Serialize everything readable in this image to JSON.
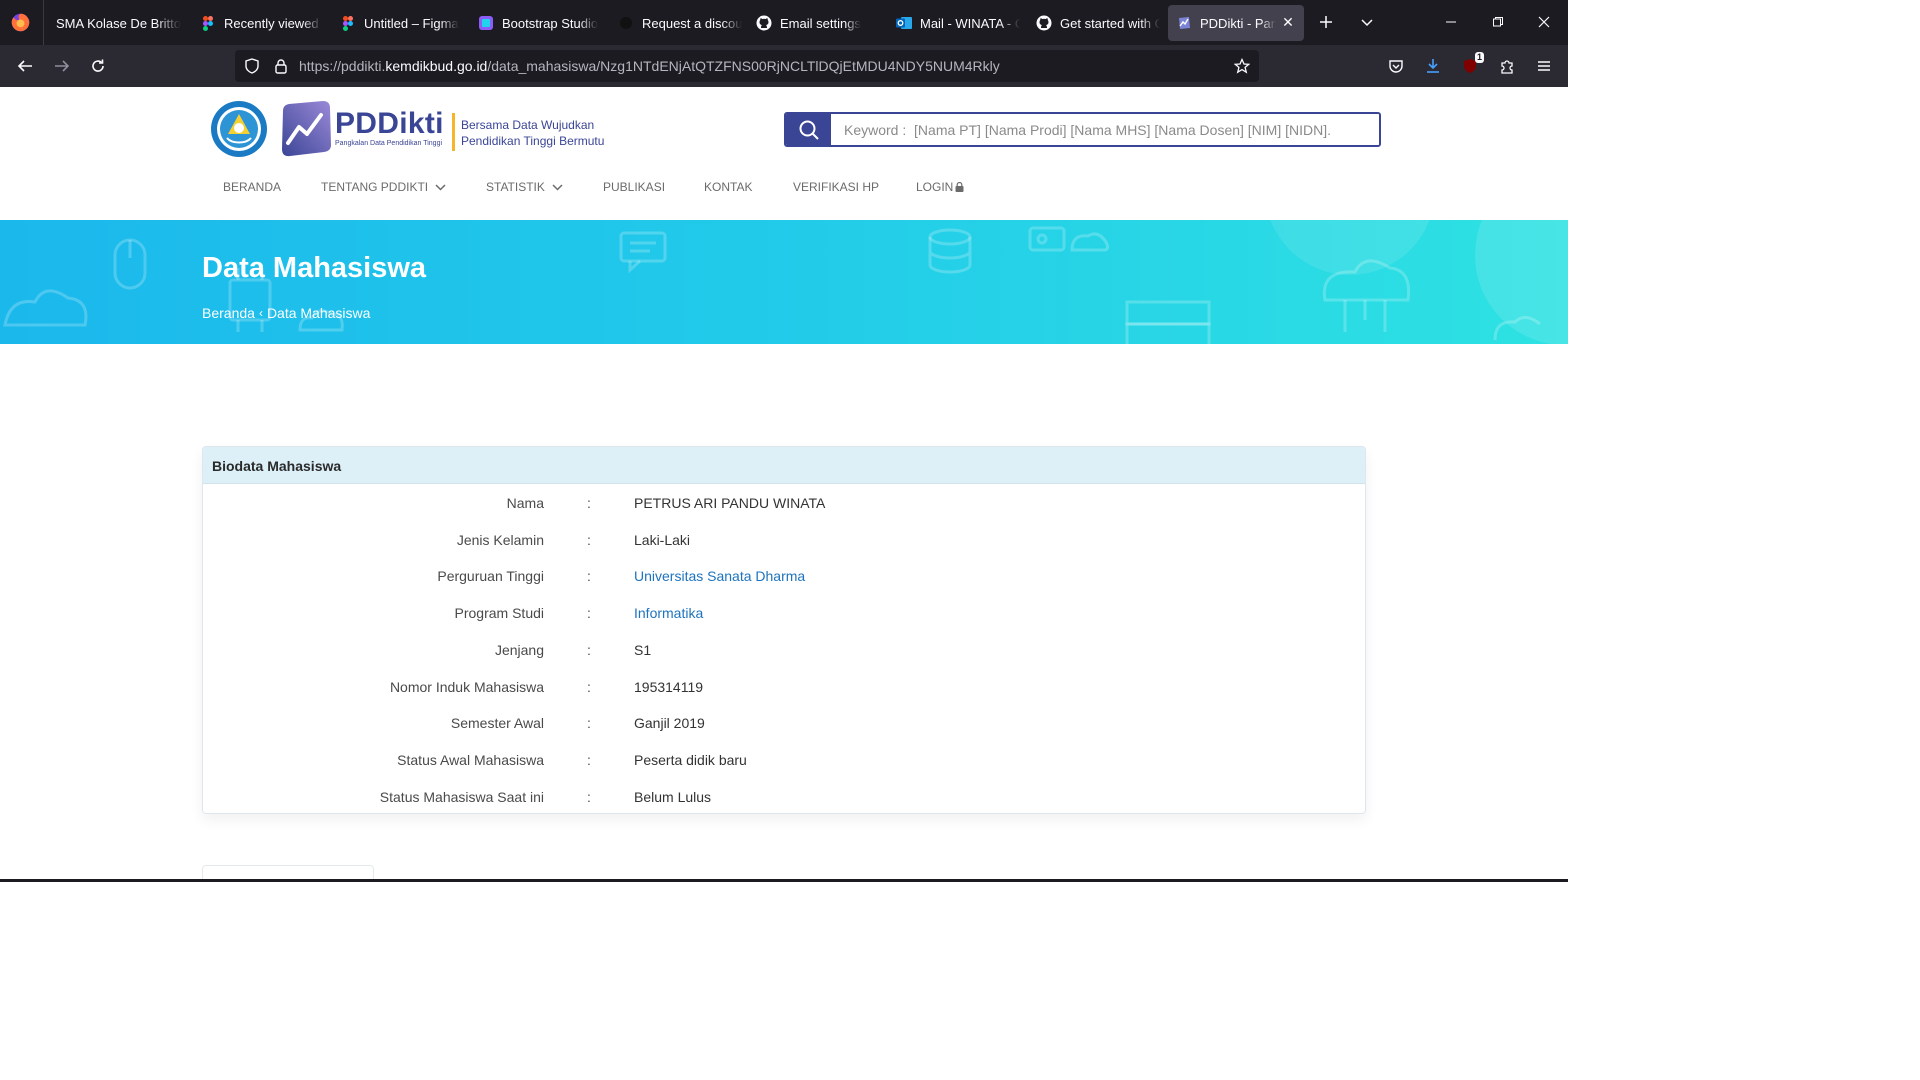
{
  "browser": {
    "tabs": [
      {
        "label": "SMA Kolase De Britto",
        "icon": "globe-icon",
        "active": false
      },
      {
        "label": "Recently viewed –",
        "icon": "figma-icon",
        "active": false
      },
      {
        "label": "Untitled – Figma",
        "icon": "figma-icon",
        "active": false
      },
      {
        "label": "Bootstrap Studio",
        "icon": "bootstrap-studio-icon",
        "active": false
      },
      {
        "label": "Request a discoun",
        "icon": "dark-circle-icon",
        "active": false
      },
      {
        "label": "Email settings",
        "icon": "github-icon",
        "active": false
      },
      {
        "label": "Mail - WINATA - C",
        "icon": "outlook-icon",
        "active": false
      },
      {
        "label": "Get started with G",
        "icon": "github-icon",
        "active": false
      },
      {
        "label": "PDDikti - Pangk",
        "icon": "pddikti-icon",
        "active": true
      }
    ],
    "url_prefix": "https://pddikti.",
    "url_host": "kemdikbud.go.id",
    "url_path": "/data_mahasiswa/Nzg1NTdENjAtQTZFNS00RjNCLTlDQjEtMDU4NDY5NUM4Rkly",
    "extension_badge": "1"
  },
  "site": {
    "brand_name": "PDDikti",
    "brand_sub": "Pangkalan Data Pendidikan Tinggi",
    "tagline_line1": "Bersama Data Wujudkan",
    "tagline_line2": "Pendidikan Tinggi Bermutu",
    "search_placeholder": "Keyword :  [Nama PT] [Nama Prodi] [Nama MHS] [Nama Dosen] [NIM] [NIDN].",
    "menu": [
      {
        "label": "BERANDA",
        "has_dropdown": false
      },
      {
        "label": "TENTANG PDDIKTI",
        "has_dropdown": true
      },
      {
        "label": "STATISTIK",
        "has_dropdown": true
      },
      {
        "label": "PUBLIKASI",
        "has_dropdown": false
      },
      {
        "label": "KONTAK",
        "has_dropdown": false
      },
      {
        "label": "VERIFIKASI HP",
        "has_dropdown": false
      },
      {
        "label": "LOGIN",
        "has_dropdown": false,
        "icon": "lock-icon"
      }
    ]
  },
  "banner": {
    "title": "Data Mahasiswa",
    "breadcrumb_home": "Beranda",
    "breadcrumb_sep": "‹",
    "breadcrumb_current": "Data Mahasiswa"
  },
  "biodata": {
    "title": "Biodata Mahasiswa",
    "colon": ":",
    "rows": [
      {
        "label": "Nama",
        "value": "PETRUS ARI PANDU WINATA",
        "link": false
      },
      {
        "label": "Jenis Kelamin",
        "value": "Laki-Laki",
        "link": false
      },
      {
        "label": "Perguruan Tinggi",
        "value": "Universitas Sanata Dharma",
        "link": true
      },
      {
        "label": "Program Studi",
        "value": "Informatika",
        "link": true
      },
      {
        "label": "Jenjang",
        "value": "S1",
        "link": false
      },
      {
        "label": "Nomor Induk Mahasiswa",
        "value": "195314119",
        "link": false
      },
      {
        "label": "Semester Awal",
        "value": "Ganjil 2019",
        "link": false
      },
      {
        "label": "Status Awal Mahasiswa",
        "value": "Peserta didik baru",
        "link": false
      },
      {
        "label": "Status Mahasiswa Saat ini",
        "value": "Belum Lulus",
        "link": false
      }
    ]
  },
  "colors": {
    "brand": "#3b4596",
    "accent": "#f5b629",
    "link": "#1e73be",
    "banner_start": "#1bb8ec",
    "banner_end": "#2ee2e2",
    "card_header": "#ddf0f8"
  }
}
